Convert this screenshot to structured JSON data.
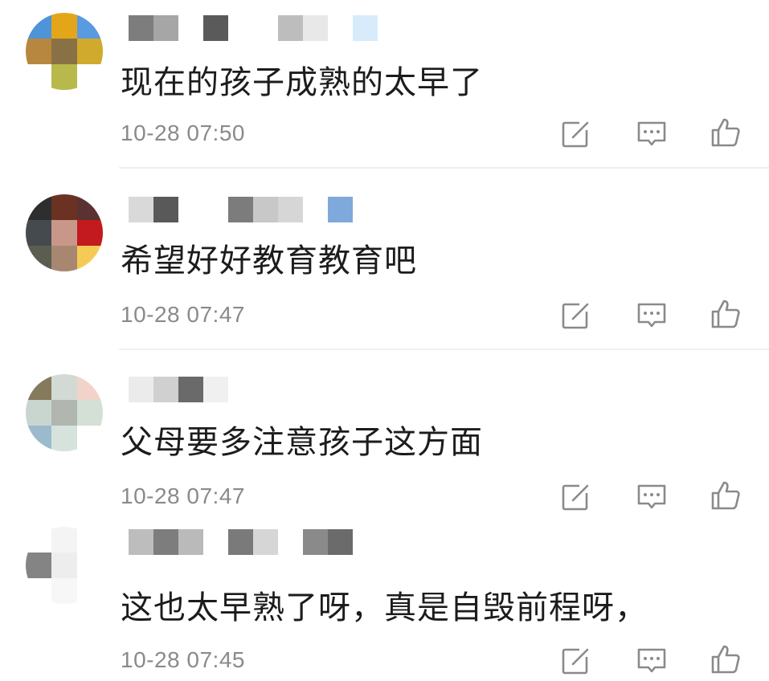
{
  "colors": {
    "text": "#1c1c1c",
    "time": "#8a8a8a",
    "icon": "#8a8a8a",
    "divider": "#efefef"
  },
  "icons": [
    "edit-icon",
    "reply-comment-icon",
    "thumbs-up-icon"
  ],
  "comments": [
    {
      "avatar_pixels": [
        "#4f93d9",
        "#e4a619",
        "#5a9ae0",
        "#b8873f",
        "#8a7145",
        "#d0aa2c",
        "#ffffff",
        "#b7b94a",
        "#ffffff"
      ],
      "name_pixels": [
        "#7d7d7d",
        "#a6a6a6",
        "#ffffff",
        "#5a5a5a",
        "#ffffff",
        "#ffffff",
        "#bdbdbd",
        "#e8e8e8",
        "#ffffff",
        "#d7ebfb"
      ],
      "text": "现在的孩子成熟的太早了",
      "time": "10-28 07:50"
    },
    {
      "avatar_pixels": [
        "#2c2f2d",
        "#6b3223",
        "#5a3232",
        "#454a4f",
        "#c9968a",
        "#c21a1e",
        "#5a5d50",
        "#a88770",
        "#f5cb55"
      ],
      "name_pixels": [
        "#d9d9d9",
        "#595959",
        "#ffffff",
        "#ffffff",
        "#7c7c7c",
        "#c8c8c8",
        "#d6d6d6",
        "#ffffff",
        "#7fa9db"
      ],
      "text": "希望好好教育教育吧",
      "time": "10-28 07:47"
    },
    {
      "avatar_pixels": [
        "#857a5c",
        "#d3dad4",
        "#f1d3c9",
        "#c9d6cf",
        "#b1b6b1",
        "#d4dfd6",
        "#9bbbcc",
        "#d6e3dd",
        "#ffffff"
      ],
      "name_pixels": [
        "#ebebeb",
        "#d0d0d0",
        "#6a6a6a",
        "#f0f0f0",
        "#ffffff"
      ],
      "text": "父母要多注意孩子这方面",
      "time": "10-28 07:47"
    },
    {
      "avatar_pixels": [
        "#ffffff",
        "#f4f4f4",
        "#ffffff",
        "#848484",
        "#ededed",
        "#ffffff",
        "#ffffff",
        "#f7f7f7",
        "#ffffff"
      ],
      "name_pixels": [
        "#bdbdbd",
        "#7d7d7d",
        "#bababa",
        "#ffffff",
        "#7a7a7a",
        "#d6d6d6",
        "#ffffff",
        "#8a8a8a",
        "#6b6b6b"
      ],
      "text": "这也太早熟了呀，真是自毁前程呀，",
      "time": "10-28 07:45"
    }
  ]
}
